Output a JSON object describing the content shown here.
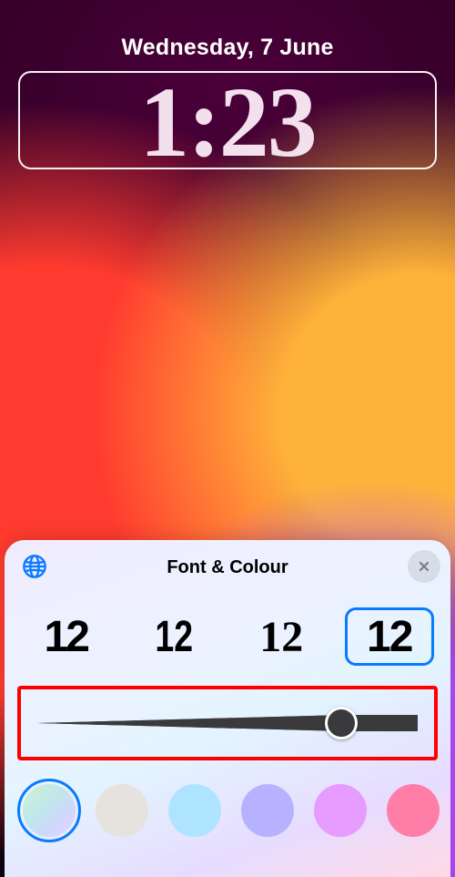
{
  "date": "Wednesday, 7 June",
  "time": "1:23",
  "sheet": {
    "title": "Font & Colour",
    "globe_icon": "globe-icon",
    "close_icon": "close-icon",
    "fonts": [
      {
        "sample": "12",
        "selected": false
      },
      {
        "sample": "12",
        "selected": false
      },
      {
        "sample": "12",
        "selected": false
      },
      {
        "sample": "12",
        "selected": true
      }
    ],
    "slider": {
      "value": 80,
      "min": 0,
      "max": 100
    },
    "colors": [
      {
        "css": "linear-gradient(135deg,#d4f0d4 0%,#bfe8e8 40%,#cfd7ff 70%,#e8d4ff 100%)",
        "selected": true
      },
      {
        "css": "#e6e2de",
        "selected": false
      },
      {
        "css": "#aee4ff",
        "selected": false
      },
      {
        "css": "#b7b2ff",
        "selected": false
      },
      {
        "css": "#e69bff",
        "selected": false
      },
      {
        "css": "#ff7ea8",
        "selected": false
      }
    ]
  }
}
